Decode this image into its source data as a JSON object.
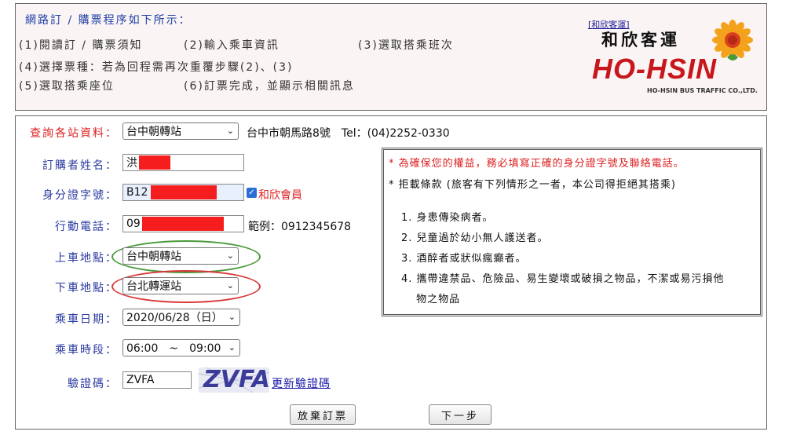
{
  "steps": {
    "title": "網路訂 / 購票程序如下所示：",
    "items": [
      "(1)閱讀訂 / 購票須知",
      "(2)輸入乘車資訊",
      "(3)選取搭乘班次",
      "(4)選擇票種：若為回程需再次重覆步驟(2)、(3)",
      "(5)選取搭乘座位",
      "(6)訂票完成，並顯示相關訊息"
    ]
  },
  "logo": {
    "link": "[和欣客運]",
    "name_cn": "和欣客運",
    "name_en": "HO-HSIN",
    "sub": "HO-HSIN BUS TRAFFIC CO.,LTD."
  },
  "form": {
    "station_label": "查詢各站資料：",
    "station_value": "台中朝轉站",
    "station_info": "台中市朝馬路8號　Tel：(04)2252-0330",
    "name_label": "訂購者姓名：",
    "name_value": "洪",
    "id_label": "身分證字號：",
    "id_value": "B12",
    "member_label": "和欣會員",
    "phone_label": "行動電話：",
    "phone_value": "09",
    "phone_example": "範例：0912345678",
    "board_label": "上車地點：",
    "board_value": "台中朝轉站",
    "alight_label": "下車地點：",
    "alight_value": "台北轉運站",
    "date_label": "乘車日期：",
    "date_value": "2020/06/28（日）",
    "time_label": "乘車時段：",
    "time_value": "06:00　~　09:00",
    "captcha_label": "驗證碼：",
    "captcha_value": "ZVFA",
    "captcha_image_text": "ZVFA",
    "refresh_captcha": "更新驗證碼",
    "cancel_button": "放棄訂票",
    "next_button": "下一步"
  },
  "rules": {
    "note_red": "* 為確保您的權益，務必填寫正確的身分證字號及聯絡電話。",
    "note_black": "* 拒載條款 (旅客有下列情形之一者，本公司得拒絕其搭乘)",
    "items": [
      "1. 身患傳染病者。",
      "2. 兒童過於幼小無人護送者。",
      "3. 酒醉者或狀似瘋癲者。",
      "4. 攜帶違禁品、危險品、易生變壞或破損之物品，不潔或易污損他",
      "　 物之物品"
    ]
  },
  "colors": {
    "label_blue": "#2a3aa0",
    "alert_red": "#d22222",
    "brand_red": "#c8161d",
    "oval_green": "#4a9a3a",
    "oval_red": "#d83a3a"
  }
}
